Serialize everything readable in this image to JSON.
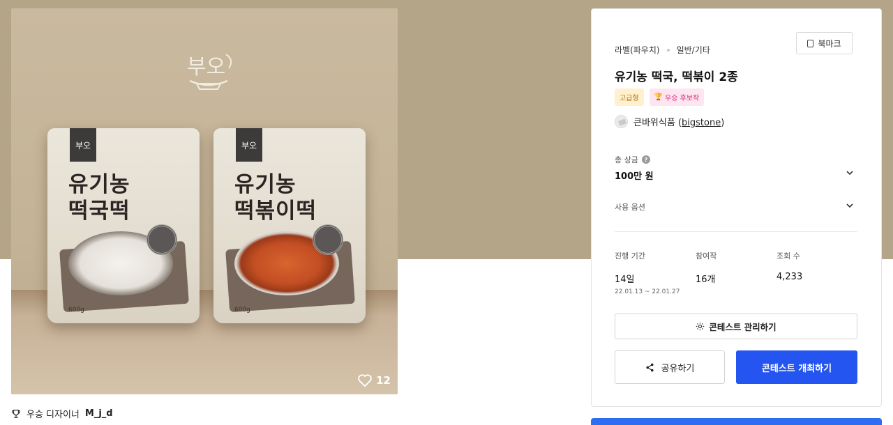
{
  "gallery": {
    "brand_logo": "부오",
    "like_count": "12",
    "packages": [
      {
        "title_line1": "유기농",
        "title_line2": "떡국떡",
        "weight": "600g",
        "tab": "부오"
      },
      {
        "title_line1": "유기농",
        "title_line2": "떡볶이떡",
        "weight": "600g",
        "tab": "부오"
      }
    ]
  },
  "winner": {
    "label": "우승 디자이너",
    "name": "M_j_d"
  },
  "contest": {
    "category": "라벨(파우치)",
    "subcategory": "일반/기타",
    "bookmark_label": "북마크",
    "title": "유기농 떡국, 떡볶이 2종",
    "badge_tier": "고급형",
    "badge_winner": "우승 후보작",
    "host_name": "큰바위식품",
    "host_id": "bigstone",
    "prize_label": "총 상금",
    "prize_value": "100만 원",
    "usage_label": "사용 옵션",
    "stats": {
      "period_label": "진행 기간",
      "period_value": "14일",
      "period_range": "22.01.13 ~ 22.01.27",
      "entries_label": "참여작",
      "entries_value": "16개",
      "views_label": "조회 수",
      "views_value": "4,233"
    },
    "manage_label": "콘테스트 관리하기",
    "share_label": "공유하기",
    "host_contest_label": "콘테스트 개최하기"
  },
  "colors": {
    "primary": "#2455f0",
    "hero_bg": "#b5a588",
    "badge_premium_bg": "#fff0cf",
    "badge_winner_bg": "#fde6f0"
  }
}
